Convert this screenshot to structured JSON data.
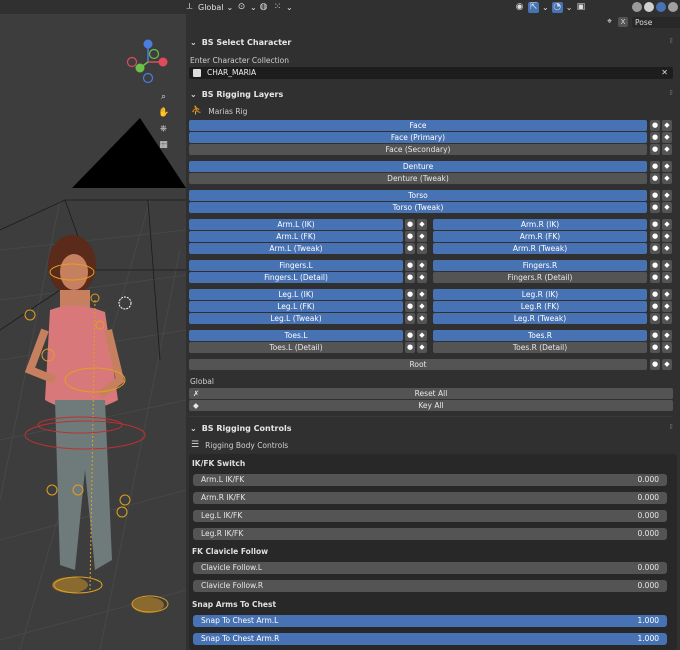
{
  "topbar": {
    "orientation": "Global"
  },
  "pose_options": {
    "close": "X",
    "label": "Pose Options"
  },
  "select_character": {
    "header": "BS Select Character",
    "collection_label": "Enter Character Collection",
    "collection_value": "CHAR_MARIA",
    "clear": "✕"
  },
  "rigging_layers": {
    "header": "BS Rigging Layers",
    "rig_name": "Marias Rig",
    "face": "Face",
    "face_primary": "Face (Primary)",
    "face_secondary": "Face (Secondary)",
    "denture": "Denture",
    "denture_tweak": "Denture (Tweak)",
    "torso": "Torso",
    "torso_tweak": "Torso (Tweak)",
    "arm_l_ik": "Arm.L (IK)",
    "arm_l_fk": "Arm.L (FK)",
    "arm_l_tweak": "Arm.L (Tweak)",
    "arm_r_ik": "Arm.R (IK)",
    "arm_r_fk": "Arm.R (FK)",
    "arm_r_tweak": "Arm.R (Tweak)",
    "fingers_l": "Fingers.L",
    "fingers_l_detail": "Fingers.L (Detail)",
    "fingers_r": "Fingers.R",
    "fingers_r_detail": "Fingers.R (Detail)",
    "leg_l_ik": "Leg.L (IK)",
    "leg_l_fk": "Leg.L (FK)",
    "leg_l_tweak": "Leg.L (Tweak)",
    "leg_r_ik": "Leg.R (IK)",
    "leg_r_fk": "Leg.R (FK)",
    "leg_r_tweak": "Leg.R (Tweak)",
    "toes_l": "Toes.L",
    "toes_l_detail": "Toes.L (Detail)",
    "toes_r": "Toes.R",
    "toes_r_detail": "Toes.R (Detail)",
    "root": "Root",
    "global_label": "Global",
    "reset_all": "Reset All",
    "key_all": "Key All"
  },
  "rigging_controls": {
    "header": "BS Rigging Controls",
    "body_controls": "Rigging Body Controls",
    "ikfk_title": "IK/FK Switch",
    "arm_l_ikfk": {
      "name": "Arm.L IK/FK",
      "value": "0.000"
    },
    "arm_r_ikfk": {
      "name": "Arm.R IK/FK",
      "value": "0.000"
    },
    "leg_l_ikfk": {
      "name": "Leg.L IK/FK",
      "value": "0.000"
    },
    "leg_r_ikfk": {
      "name": "Leg.R IK/FK",
      "value": "0.000"
    },
    "clavicle_title": "FK Clavicle Follow",
    "clav_l": {
      "name": "Clavicle Follow.L",
      "value": "0.000"
    },
    "clav_r": {
      "name": "Clavicle Follow.R",
      "value": "0.000"
    },
    "snap_title": "Snap Arms To Chest",
    "snap_l": {
      "name": "Snap To Chest Arm.L",
      "value": "1.000"
    },
    "snap_r": {
      "name": "Snap To Chest Arm.R",
      "value": "1.000"
    }
  },
  "colors": {
    "accent": "#4772b3",
    "panel_bg": "#303030",
    "button_bg": "#545454",
    "viewport_bg": "#3d3d3d",
    "bone_yellow": "#e0a020",
    "bone_red": "#c03030"
  }
}
